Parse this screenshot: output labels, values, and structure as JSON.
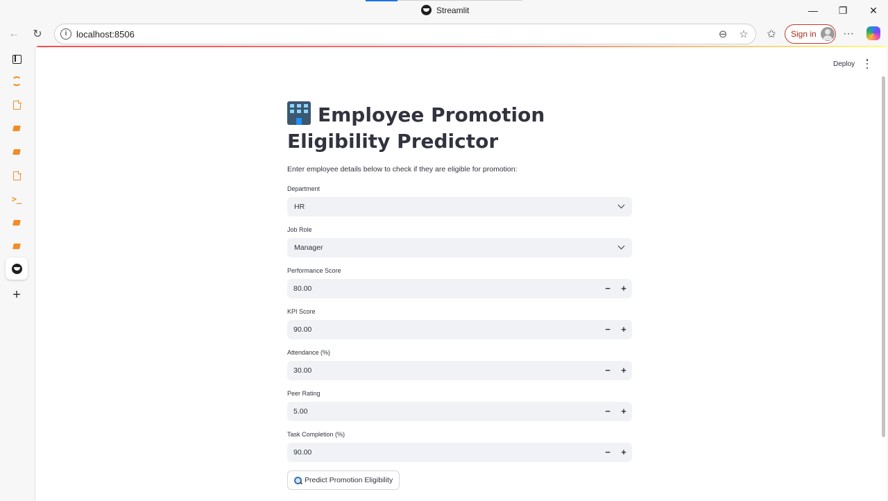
{
  "browser": {
    "window_title": "Streamlit",
    "url": "localhost:8506",
    "sign_in_label": "Sign in",
    "minimize": "—",
    "restore": "❐",
    "close": "✕",
    "back": "←",
    "reload": "↻",
    "zoom": "⊖",
    "favorite": "☆",
    "favorites": "✩",
    "more": "···"
  },
  "sidebar": {
    "items": [
      "panel-icon",
      "arc-icon",
      "doc-icon",
      "book-icon",
      "book-icon",
      "doc-icon",
      "terminal-icon",
      "book-icon",
      "book-icon",
      "streamlit-icon",
      "plus-icon"
    ],
    "terminal_glyph": ">_",
    "plus_glyph": "+"
  },
  "app": {
    "deploy_label": "Deploy",
    "title": "Employee Promotion Eligibility Predictor",
    "description": "Enter employee details below to check if they are eligible for promotion:",
    "department": {
      "label": "Department",
      "value": "HR"
    },
    "job_role": {
      "label": "Job Role",
      "value": "Manager"
    },
    "performance_score": {
      "label": "Performance Score",
      "value": "80.00"
    },
    "kpi_score": {
      "label": "KPI Score",
      "value": "90.00"
    },
    "attendance": {
      "label": "Attendance (%)",
      "value": "30.00"
    },
    "peer_rating": {
      "label": "Peer Rating",
      "value": "5.00"
    },
    "task_completion": {
      "label": "Task Completion (%)",
      "value": "90.00"
    },
    "minus": "−",
    "plus": "+",
    "predict_button": "Predict Promotion Eligibility"
  },
  "colors": {
    "accent": "#ff4b4b",
    "input_bg": "#f0f2f6",
    "text": "#31333f",
    "sidebar_icon": "#f28c28"
  }
}
